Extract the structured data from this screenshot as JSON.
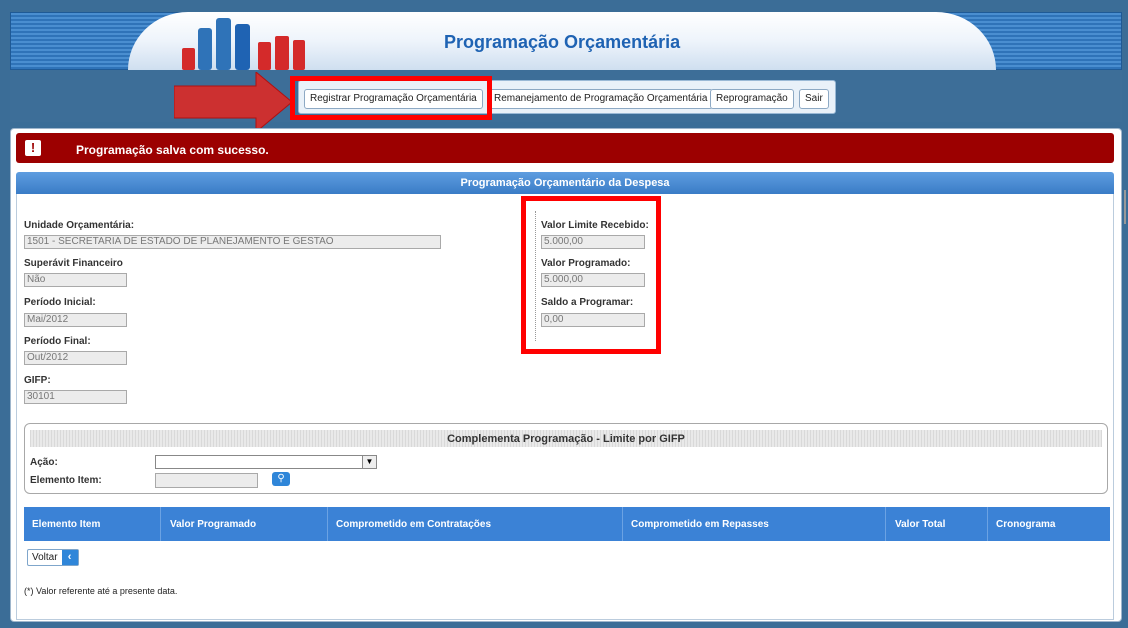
{
  "header": {
    "title": "Programação Orçamentária",
    "colors": {
      "title": "#1f63b3",
      "banner": "#2f73b8"
    }
  },
  "nav": {
    "items": [
      {
        "label": "Registrar Programação Orçamentária"
      },
      {
        "label": "Remanejamento de Programação Orçamentária"
      },
      {
        "label": "Reprogramação"
      },
      {
        "label": "Sair"
      }
    ]
  },
  "alert": {
    "icon": "exclamation-icon",
    "message": "Programação salva com sucesso.",
    "color": "#9c0000"
  },
  "form": {
    "section_title": "Programação Orçamentário da Despesa",
    "unidade_label": "Unidade Orçamentária:",
    "unidade_value": "1501 - SECRETARIA DE ESTADO DE PLANEJAMENTO E GESTAO",
    "superavit_label": "Superávit Financeiro",
    "superavit_value": "Não",
    "periodo_inicial_label": "Período Inicial:",
    "periodo_inicial_value": "Mai/2012",
    "periodo_final_label": "Período Final:",
    "periodo_final_value": "Out/2012",
    "gifp_label": "GIFP:",
    "gifp_value": "30101",
    "limite_label": "Valor Limite Recebido:",
    "limite_value": "5.000,00",
    "programado_label": "Valor Programado:",
    "programado_value": "5.000,00",
    "saldo_label": "Saldo a Programar:",
    "saldo_value": "0,00"
  },
  "complementa": {
    "title": "Complementa Programação - Limite por GIFP",
    "acao_label": "Ação:",
    "acao_value": "",
    "elemento_label": "Elemento Item:",
    "elemento_value": ""
  },
  "table": {
    "columns": [
      "Elemento Item",
      "Valor Programado",
      "Comprometido em Contratações",
      "Comprometido em Repasses",
      "Valor Total",
      "Cronograma"
    ]
  },
  "voltar": {
    "label": "Voltar",
    "icon": "chevron-left-icon"
  },
  "footnote": "(*) Valor referente até a presente data."
}
